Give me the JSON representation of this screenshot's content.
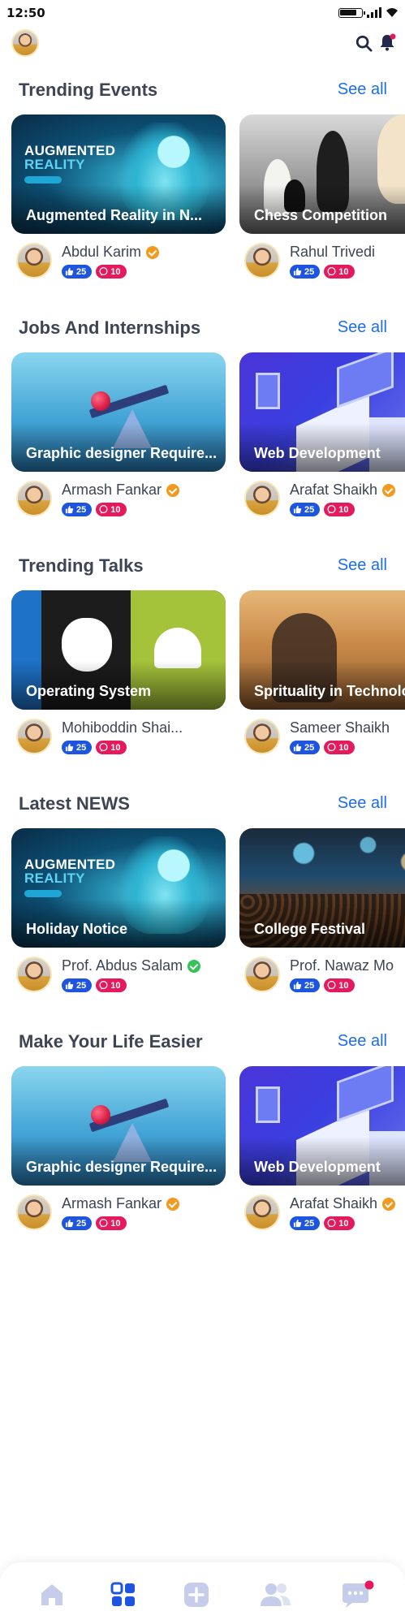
{
  "status_bar": {
    "time": "12:50"
  },
  "header": {
    "avatar_icon": "user-avatar",
    "search_icon": "search-icon",
    "bell_icon": "bell-icon"
  },
  "sections": [
    {
      "title": "Trending Events",
      "see_all": "See all",
      "cards": [
        {
          "title": "Augmented Reality in N...",
          "author": "Abdul Karim",
          "verified": "orange",
          "likes": "25",
          "comments": "10",
          "image": "augmented-reality",
          "image_text_1": "AUGMENTED",
          "image_text_2": "REALITY"
        },
        {
          "title": "Chess Competition",
          "author": "Rahul Trivedi",
          "verified": "",
          "likes": "25",
          "comments": "10",
          "image": "chess"
        }
      ]
    },
    {
      "title": "Jobs And Internships",
      "see_all": "See all",
      "cards": [
        {
          "title": "Graphic designer Require...",
          "author": "Armash Fankar",
          "verified": "orange",
          "likes": "25",
          "comments": "10",
          "image": "balance"
        },
        {
          "title": "Web Development",
          "author": "Arafat Shaikh",
          "verified": "orange",
          "likes": "25",
          "comments": "10",
          "image": "web-dev"
        }
      ]
    },
    {
      "title": "Trending Talks",
      "see_all": "See all",
      "cards": [
        {
          "title": "Operating System",
          "author": "Mohiboddin Shai...",
          "verified": "",
          "likes": "25",
          "comments": "10",
          "image": "operating-system"
        },
        {
          "title": "Sprituality in Technology",
          "author": "Sameer Shaikh",
          "verified": "",
          "likes": "25",
          "comments": "10",
          "image": "spirituality"
        }
      ]
    },
    {
      "title": "Latest NEWS",
      "see_all": "See all",
      "cards": [
        {
          "title": "Holiday Notice",
          "author": "Prof. Abdus Salam",
          "verified": "green",
          "likes": "25",
          "comments": "10",
          "image": "augmented-reality",
          "image_text_1": "AUGMENTED",
          "image_text_2": "REALITY"
        },
        {
          "title": "College Festival",
          "author": "Prof. Nawaz Mo",
          "verified": "",
          "likes": "25",
          "comments": "10",
          "image": "festival"
        }
      ]
    },
    {
      "title": "Make Your Life Easier",
      "see_all": "See all",
      "cards": [
        {
          "title": "Graphic designer Require...",
          "author": "Armash Fankar",
          "verified": "orange",
          "likes": "25",
          "comments": "10",
          "image": "balance"
        },
        {
          "title": "Web Development",
          "author": "Arafat Shaikh",
          "verified": "orange",
          "likes": "25",
          "comments": "10",
          "image": "web-dev"
        }
      ]
    }
  ],
  "bottom_nav": [
    {
      "icon": "home-icon",
      "active": false
    },
    {
      "icon": "grid-icon",
      "active": true
    },
    {
      "icon": "add-icon",
      "active": false
    },
    {
      "icon": "users-icon",
      "active": false
    },
    {
      "icon": "chat-icon",
      "active": false
    }
  ],
  "colors": {
    "accent": "#1d6ee6",
    "like": "#1d55e0",
    "comment": "#e5195c",
    "verified_orange": "#f39a1e",
    "verified_green": "#35c25a",
    "nav_inactive": "#c5cdea",
    "nav_active": "#1d55e0"
  }
}
